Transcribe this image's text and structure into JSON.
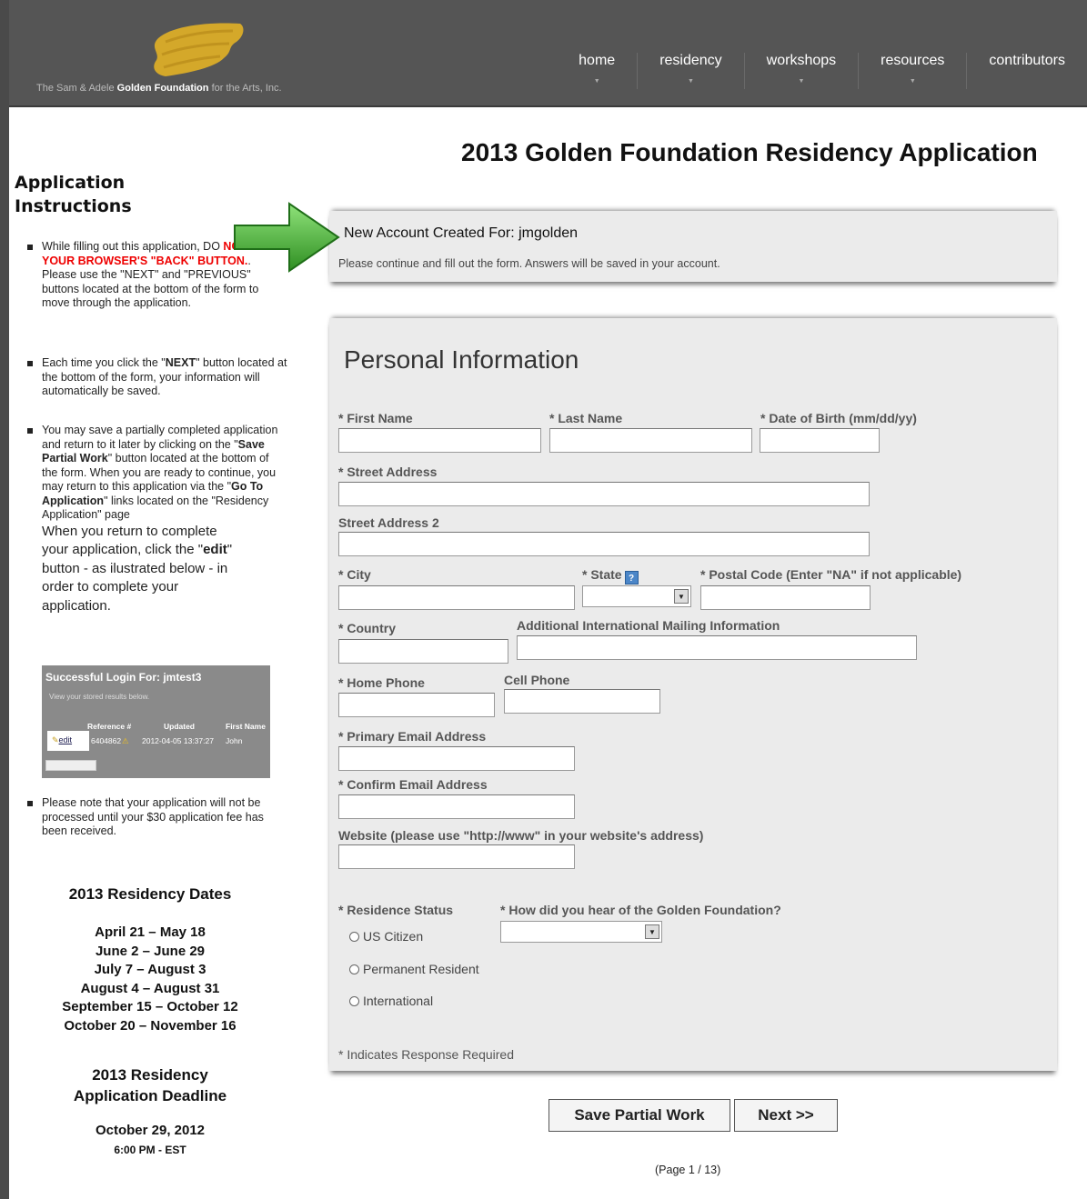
{
  "header": {
    "tagline_prefix": "The Sam & Adele",
    "tagline_bold": "Golden Foundation",
    "tagline_suffix": "for the Arts, Inc.",
    "brand_gold": "#d4a82a",
    "nav": [
      {
        "label": "home"
      },
      {
        "label": "residency"
      },
      {
        "label": "workshops"
      },
      {
        "label": "resources"
      },
      {
        "label": "contributors"
      }
    ]
  },
  "sidebar": {
    "heading": "Application Instructions",
    "bullet1": {
      "pre": "While filling out this application, DO",
      "red": "NOT USE YOUR BROWSER'S \"BACK\" BUTTON.",
      "post": ". Please use the \"NEXT\" and \"PREVIOUS\" buttons located at the bottom of the form to move through the application."
    },
    "bullet2": {
      "pre": "Each time you click the \"",
      "bold": "NEXT",
      "post": "\" button located at the bottom of the form, your information will automatically be saved."
    },
    "bullet3": {
      "a": "You may save a partially completed application and return to it later by clicking on the \"",
      "b": "Save Partial Work",
      "c": "\" button located at the bottom of the form. When you are ready to continue, you may return to this application via the \"",
      "d": "Go To Application",
      "e": "\" links located on the \"Residency Application\" page",
      "f": "When you return to complete your application, click the \"",
      "g": "edit",
      "h": "\" button - as ilustrated below - in order to complete your application."
    },
    "example": {
      "title": "Successful Login For: jmtest3",
      "subtitle": "View your stored results below.",
      "col_ref": "Reference #",
      "col_updated": "Updated",
      "col_first": "First Name",
      "edit": "edit",
      "ref": "6404862",
      "updated": "2012-04-05 13:37:27",
      "first": "John"
    },
    "bullet4": "Please note that your application will not be processed until your $30 application fee has been received.",
    "dates_heading": "2013 Residency Dates",
    "dates": [
      "April 21 – May 18",
      "June 2 – June 29",
      "July 7 – August 3",
      "August 4 – August 31",
      "September 15 – October 12",
      "October 20 – November 16"
    ],
    "deadline_heading_1": "2013 Residency",
    "deadline_heading_2": "Application Deadline",
    "deadline_date": "October 29, 2012",
    "deadline_time": "6:00 PM - EST"
  },
  "main": {
    "title": "2013 Golden Foundation Residency Application",
    "notice_title": "New Account Created For: jmgolden",
    "notice_text": "Please continue and fill out the form. Answers will be saved in your account.",
    "section_title": "Personal Information",
    "labels": {
      "first_name": "* First Name",
      "last_name": "* Last Name",
      "dob": "* Date of Birth (mm/dd/yy)",
      "street": "* Street Address",
      "street2": "Street Address 2",
      "city": "* City",
      "state": "* State",
      "state_help": "?",
      "postal": "* Postal Code (Enter \"NA\" if not applicable)",
      "country": "* Country",
      "intl": "Additional International Mailing Information",
      "home_phone": "* Home Phone",
      "cell_phone": "Cell Phone",
      "email": "* Primary Email Address",
      "confirm_email": "* Confirm Email Address",
      "website": "Website (please use \"http://www\" in your website's address)",
      "residence": "* Residence Status",
      "hear": "* How did you hear of the Golden Foundation?"
    },
    "residence_options": [
      "US Citizen",
      "Permanent Resident",
      "International"
    ],
    "required_note": "* Indicates Response Required",
    "save_button": "Save Partial Work",
    "next_button": "Next >>",
    "page_indicator": "(Page 1 / 13)"
  }
}
